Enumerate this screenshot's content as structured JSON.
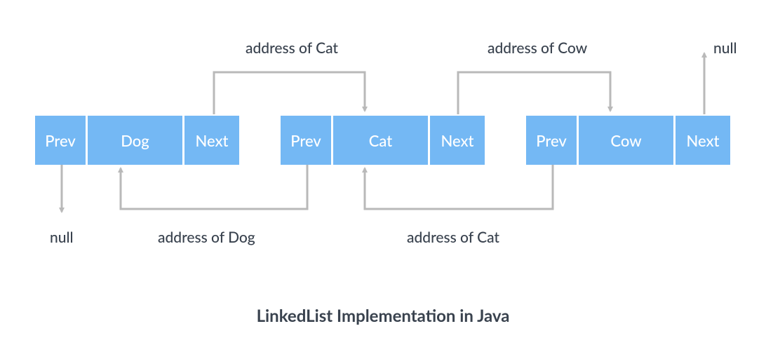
{
  "nodes": [
    {
      "prev": "Prev",
      "data": "Dog",
      "next": "Next"
    },
    {
      "prev": "Prev",
      "data": "Cat",
      "next": "Next"
    },
    {
      "prev": "Prev",
      "data": "Cow",
      "next": "Next"
    }
  ],
  "labels": {
    "top_next1": "address of Cat",
    "top_next2": "address of Cow",
    "top_null": "null",
    "bottom_prev1": "null",
    "bottom_prev2": "address of Dog",
    "bottom_prev3": "address of Cat"
  },
  "caption": "LinkedList Implementation in Java"
}
